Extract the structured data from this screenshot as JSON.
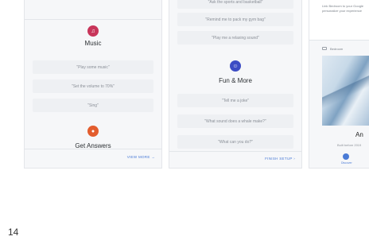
{
  "panel1": {
    "music": {
      "title": "Music",
      "icon": "music-note-icon",
      "color": "#c8355a",
      "chips": [
        "\"Play some music\"",
        "\"Set the volume to 70%\"",
        "\"Sing\""
      ]
    },
    "answers": {
      "title": "Get Answers",
      "icon": "answers-icon",
      "color": "#e35d2e"
    },
    "footer_link": "VIEW MORE →"
  },
  "panel2": {
    "top_chips": [
      "\"Ask the sports and basketball\"",
      "\"Remind me to pack my gym bag\"",
      "\"Play me a relaxing sound\""
    ],
    "fun": {
      "title": "Fun & More",
      "icon": "smiley-icon",
      "color": "#3c4cc4",
      "chips": [
        "\"Tell me a joke\"",
        "\"What sound does a whale make?\"",
        "\"What can you do?\""
      ]
    },
    "footer_link": "FINISH SETUP ›"
  },
  "panel3": {
    "card_text_1": "Link Bedroom to your Google",
    "card_text_2": "personalize your experience",
    "device_label": "Bedroom",
    "caption": "An",
    "subcaption": "Built before 2019",
    "nav_label": "Discover",
    "nav_icon": "compass-icon"
  },
  "page_number": "14"
}
